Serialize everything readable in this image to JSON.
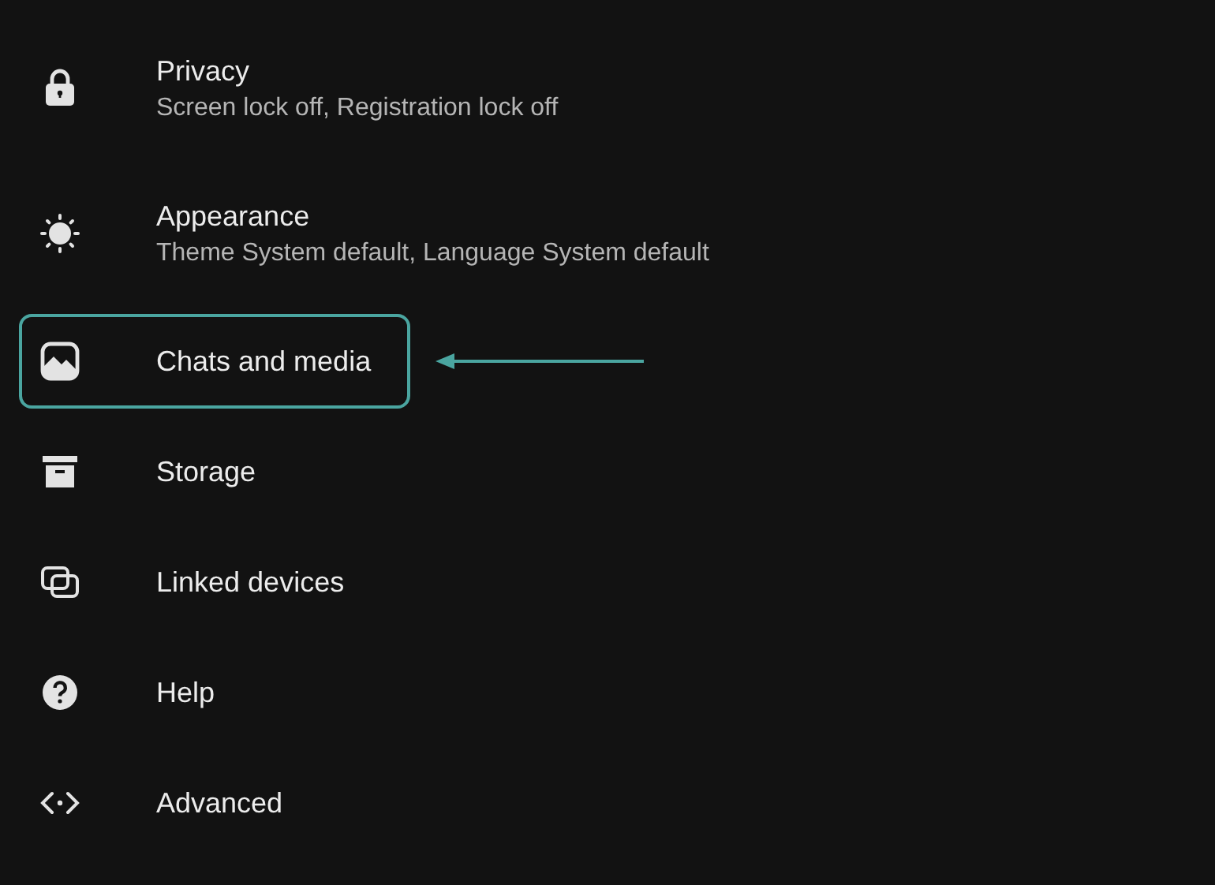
{
  "settings": [
    {
      "title": "Privacy",
      "subtitle": "Screen lock off, Registration lock off",
      "highlighted": false
    },
    {
      "title": "Appearance",
      "subtitle": "Theme System default, Language System default",
      "highlighted": false
    },
    {
      "title": "Chats and media",
      "highlighted": true
    },
    {
      "title": "Storage",
      "highlighted": false
    },
    {
      "title": "Linked devices",
      "highlighted": false
    },
    {
      "title": "Help",
      "highlighted": false
    },
    {
      "title": "Advanced",
      "highlighted": false
    }
  ]
}
